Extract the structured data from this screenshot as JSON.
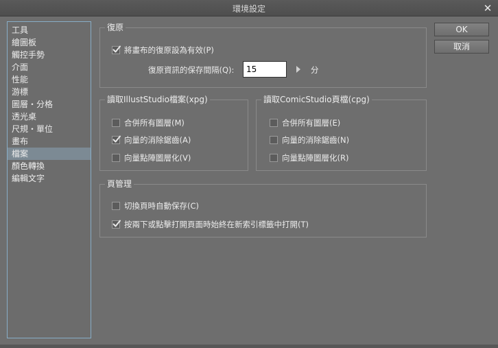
{
  "window": {
    "title": "環境設定",
    "close_glyph": "✕"
  },
  "sidebar": {
    "items": [
      {
        "label": "工具",
        "selected": false
      },
      {
        "label": "繪圖板",
        "selected": false
      },
      {
        "label": "觸控手勢",
        "selected": false
      },
      {
        "label": "介面",
        "selected": false
      },
      {
        "label": "性能",
        "selected": false
      },
      {
        "label": "游標",
        "selected": false
      },
      {
        "label": "圖層・分格",
        "selected": false
      },
      {
        "label": "透光桌",
        "selected": false
      },
      {
        "label": "尺規・單位",
        "selected": false
      },
      {
        "label": "畫布",
        "selected": false
      },
      {
        "label": "檔案",
        "selected": true
      },
      {
        "label": "顏色轉換",
        "selected": false
      },
      {
        "label": "編輯文字",
        "selected": false
      }
    ]
  },
  "restore": {
    "title": "復原",
    "enable_label": "將畫布的復原設為有效(P)",
    "enable_checked": true,
    "interval_label": "復原資訊的保存間隔(Q):",
    "interval_value": "15",
    "interval_unit": "分"
  },
  "illust": {
    "title": "讀取IllustStudio檔案(xpg)",
    "options": [
      {
        "label": "合併所有圖層(M)",
        "checked": false
      },
      {
        "label": "向量的消除鋸齒(A)",
        "checked": true
      },
      {
        "label": "向量點陣圖層化(V)",
        "checked": false
      }
    ]
  },
  "comic": {
    "title": "讀取ComicStudio頁檔(cpg)",
    "options": [
      {
        "label": "合併所有圖層(E)",
        "checked": false
      },
      {
        "label": "向量的消除鋸齒(N)",
        "checked": false
      },
      {
        "label": "向量點陣圖層化(R)",
        "checked": false
      }
    ]
  },
  "page": {
    "title": "頁管理",
    "options": [
      {
        "label": "切換頁時自動保存(C)",
        "checked": false
      },
      {
        "label": "按兩下或點擊打開頁面時始終在新索引標籤中打開(T)",
        "checked": true
      }
    ]
  },
  "buttons": {
    "ok": "OK",
    "cancel": "取消"
  }
}
